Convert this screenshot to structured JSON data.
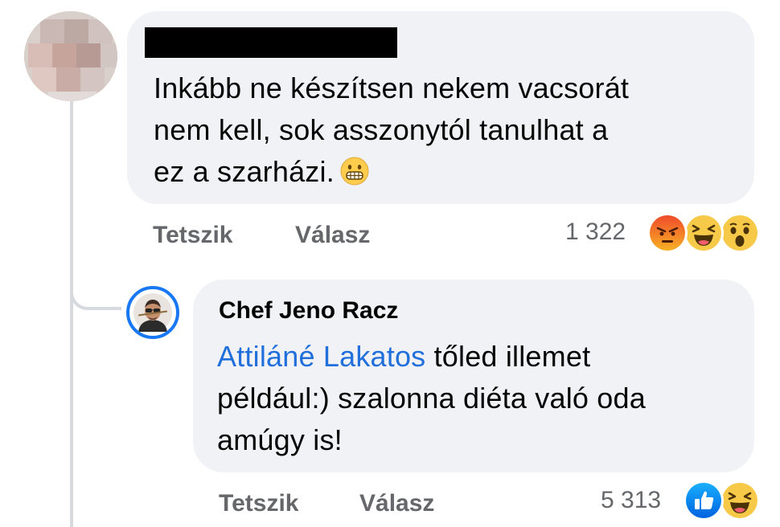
{
  "comment_1": {
    "author_redacted": true,
    "text": "Inkább ne készítsen nekem vacsorát nem kell, sok asszonytól tanulhat a ez a szarházi.",
    "text_line1": "Inkább ne készítsen nekem vacsorát",
    "text_line2": "nem kell, sok asszonytól tanulhat a",
    "text_line3": "ez a szarházi.",
    "emoji": "grimacing-face-emoji",
    "actions": {
      "like_label": "Tetszik",
      "reply_label": "Válasz"
    },
    "reaction_count": "1 322",
    "reactions": [
      "angry-reaction-icon",
      "haha-reaction-icon",
      "wow-reaction-icon"
    ]
  },
  "comment_2": {
    "author": "Chef Jeno Racz",
    "mention": "Attiláné Lakatos",
    "text_after_mention_line1": " tőled illemet",
    "text_line2": "például:) szalonna diéta való oda",
    "text_line3": "amúgy is!",
    "actions": {
      "like_label": "Tetszik",
      "reply_label": "Válasz"
    },
    "reaction_count": "5 313",
    "reactions": [
      "like-reaction-icon",
      "haha-reaction-icon"
    ]
  },
  "colors": {
    "bubble": "#f0f2f5",
    "mention": "#216fdb",
    "secondary_text": "#65676b",
    "accent": "#1877f2",
    "thread_line": "#d6d9de"
  }
}
